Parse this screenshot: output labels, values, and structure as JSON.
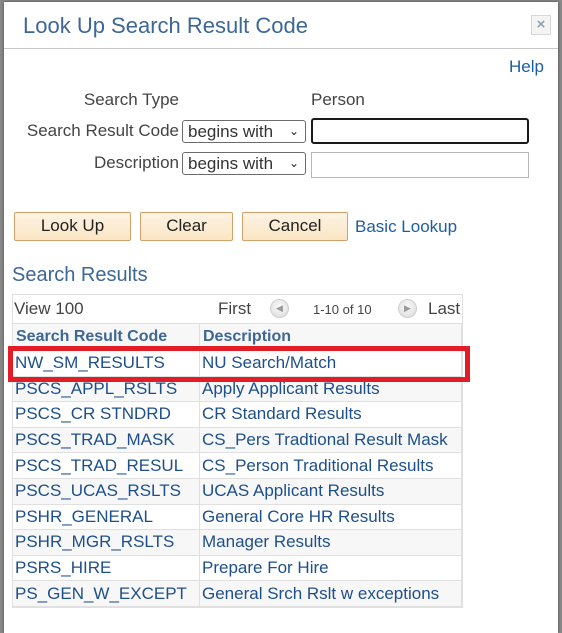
{
  "dialog": {
    "title": "Look Up Search Result Code",
    "close_icon": "close-icon",
    "help_label": "Help"
  },
  "criteria": {
    "search_type": {
      "label": "Search Type",
      "value": "Person"
    },
    "fields": [
      {
        "label": "Search Result Code",
        "operator": "begins with",
        "value": "",
        "focused": true
      },
      {
        "label": "Description",
        "operator": "begins with",
        "value": "",
        "focused": false
      }
    ]
  },
  "buttons": {
    "lookup": "Look Up",
    "clear": "Clear",
    "cancel": "Cancel",
    "basic_lookup": "Basic Lookup"
  },
  "results": {
    "title": "Search Results",
    "view_label": "View 100",
    "first_label": "First",
    "range_label": "1-10 of 10",
    "last_label": "Last",
    "columns": [
      "Search Result Code",
      "Description"
    ],
    "rows": [
      {
        "code": "NW_SM_RESULTS",
        "description": "NU Search/Match",
        "highlighted": true
      },
      {
        "code": "PSCS_APPL_RSLTS",
        "description": "Apply Applicant Results"
      },
      {
        "code": "PSCS_CR STNDRD",
        "description": "CR Standard Results"
      },
      {
        "code": "PSCS_TRAD_MASK",
        "description": "CS_Pers Tradtional Result Mask"
      },
      {
        "code": "PSCS_TRAD_RESUL",
        "description": "CS_Person Traditional Results"
      },
      {
        "code": "PSCS_UCAS_RSLTS",
        "description": "UCAS Applicant Results"
      },
      {
        "code": "PSHR_GENERAL",
        "description": "General Core HR Results"
      },
      {
        "code": "PSHR_MGR_RSLTS",
        "description": "Manager Results"
      },
      {
        "code": "PSRS_HIRE",
        "description": "Prepare For Hire"
      },
      {
        "code": "PS_GEN_W_EXCEPT",
        "description": "General Srch Rslt w exceptions"
      }
    ]
  },
  "colors": {
    "title": "#3d6796",
    "link": "#1d5da3",
    "highlight_border": "#e31d25",
    "button_border": "#d4a06b"
  }
}
